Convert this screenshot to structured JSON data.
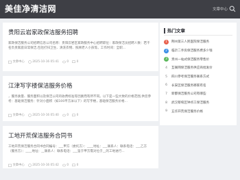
{
  "header": {
    "logo": "美佳净清洁网",
    "nav_label": "文章中心",
    "search_icon": "search-icon"
  },
  "articles": [
    {
      "title": "贵阳云岩家政保洁服务招聘",
      "excerpt": "家政保洁服务公司招聘信息公司名称：贵阳云岩区家政服务中心招聘职位：家政保洁员招聘人数：若干名负责家庭日常保洁,包括打扫卫生、清洗衣物、照顾老人小孩等。工作时间：全职...",
      "author": "文章中心",
      "date": "2025-10-16 05:41",
      "views": "0",
      "comments": "0"
    },
    {
      "title": "江津写字楼保洁服务价格",
      "excerpt": "，服务质量、服务面积以及保洁公司的收费标准等因素而有所不同。以下是一些大致的价格范围,供您参考：基础保洁服务：针对小面积（如100平方米以下）的写字楼，基础保洁服务价格...",
      "author": "文章中心",
      "date": "2025-10-16 05:40",
      "views": "0",
      "comments": "0"
    },
    {
      "title": "工地开荒保洁服务合同书",
      "excerpt": "工地开荒保洁服务合同书合同编号：___甲方（委托方）：____地址：___联系人：联系电话：___乙方（服务方）：____地址：__联系人：联系电话：___鉴于甲方需对位于__的工地进行...",
      "author": "文章中心",
      "date": "2025-10-16 05:42",
      "views": "0",
      "comments": "0"
    }
  ],
  "sidebar": {
    "title": "热门文章",
    "items": [
      {
        "rank": "1",
        "label": "荆州第三人民医院保洁服务",
        "color": "#e8604c"
      },
      {
        "rank": "2",
        "label": "临沂二手房保洁服务费多少钱",
        "color": "#3a8ee6"
      },
      {
        "rank": "3",
        "label": "贵州一站式保洁服务零售价",
        "color": "#5cb85c"
      },
      {
        "rank": "4",
        "label": "互联网保洁服务供应商批发价",
        "color": ""
      },
      {
        "rank": "5",
        "label": "四川参考保洁服务联系方式",
        "color": ""
      },
      {
        "rank": "6",
        "label": "长安区保洁服务哪家有名",
        "color": ""
      },
      {
        "rank": "7",
        "label": "新都保洁服务公司有哪些",
        "color": ""
      },
      {
        "rank": "8",
        "label": "武汉蔡甸区钟点工保洁服务",
        "color": ""
      },
      {
        "rank": "9",
        "label": "五华开荒保洁服务价格",
        "color": ""
      }
    ]
  }
}
